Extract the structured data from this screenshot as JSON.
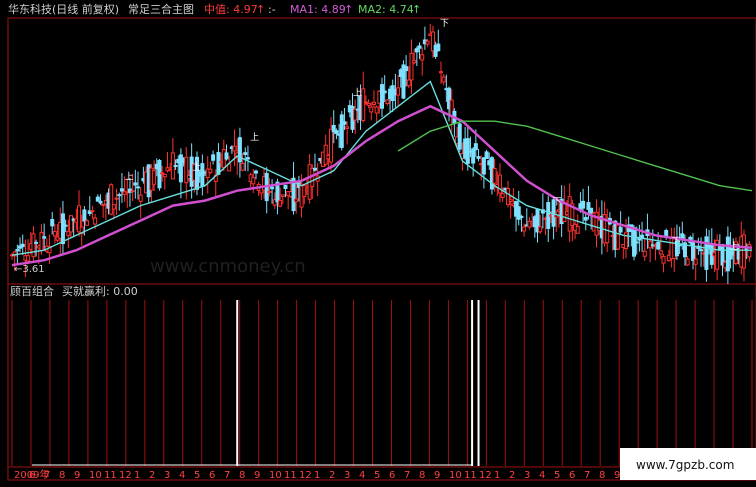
{
  "header": {
    "stock": "华东科技(日线 前复权)",
    "formula": "常足三合主图",
    "mid_label": "中值: 4.97",
    "mid_arrow": "↑",
    "sep": ":-",
    "ma1_label": "MA1: 4.89",
    "ma1_arrow": "↑",
    "ma2_label": "MA2: 4.74",
    "ma2_arrow": "↑"
  },
  "sub": {
    "title": "顾百组合",
    "signal_label": "买就赢利: 0.00"
  },
  "low_mark": "←3.61",
  "watermark": "www.7gpzb.com",
  "faint_watermark": "www.cnmoney.cn",
  "colors": {
    "up_candle": "#ff3030",
    "down_candle": "#7fe0ff",
    "ma_mid": "#66e0e0",
    "ma1": "#d050d0",
    "ma2": "#50c050",
    "grid": "#a01010",
    "signal": "#ffffff"
  },
  "chart_data": [
    {
      "type": "candlestick",
      "title": "华东科技(日线 前复权)",
      "ylim": [
        3.4,
        8.6
      ],
      "series": [
        {
          "name": "中值",
          "current": 4.97,
          "values": [
            3.9,
            4.0,
            4.3,
            4.6,
            4.9,
            5.1,
            5.3,
            5.9,
            5.6,
            5.3,
            5.6,
            6.4,
            6.9,
            7.4,
            5.8,
            5.3,
            4.9,
            4.7,
            4.5,
            4.3,
            4.2,
            4.1,
            4.0,
            4.0
          ]
        },
        {
          "name": "MA1",
          "current": 4.89,
          "values": [
            3.7,
            3.8,
            4.0,
            4.3,
            4.6,
            4.9,
            5.0,
            5.2,
            5.3,
            5.4,
            5.7,
            6.2,
            6.6,
            6.9,
            6.6,
            6.0,
            5.4,
            5.0,
            4.7,
            4.5,
            4.3,
            4.2,
            4.1,
            4.05
          ]
        },
        {
          "name": "MA2",
          "current": 4.74,
          "values": [
            null,
            null,
            null,
            null,
            null,
            null,
            null,
            null,
            null,
            null,
            null,
            null,
            6.0,
            6.4,
            6.6,
            6.6,
            6.5,
            6.3,
            6.1,
            5.9,
            5.7,
            5.5,
            5.3,
            5.2
          ]
        }
      ],
      "closes": [
        3.9,
        4.2,
        4.6,
        5.0,
        5.3,
        5.7,
        5.5,
        6.1,
        5.2,
        5.1,
        6.2,
        7.0,
        7.2,
        8.4,
        6.1,
        5.5,
        4.5,
        4.8,
        4.6,
        4.2,
        4.1,
        4.0,
        3.9,
        4.0
      ],
      "low_annotation": 3.61
    },
    {
      "type": "bar",
      "title": "顾百组合",
      "series": [
        {
          "name": "买就赢利",
          "current": 0.0
        }
      ],
      "signals_at": [
        7,
        14.3,
        14.5
      ]
    }
  ],
  "x_axis": {
    "ticks": [
      "2009年",
      "6",
      "7",
      "8",
      "9",
      "10",
      "11",
      "12",
      "1",
      "2",
      "3",
      "4",
      "5",
      "6",
      "7",
      "8",
      "9",
      "10",
      "11",
      "12",
      "1",
      "2",
      "3",
      "4",
      "5",
      "6",
      "7",
      "8",
      "9",
      "10",
      "11",
      "12",
      "1",
      "2",
      "3",
      "4",
      "5",
      "6",
      "7",
      "8",
      "9"
    ]
  }
}
